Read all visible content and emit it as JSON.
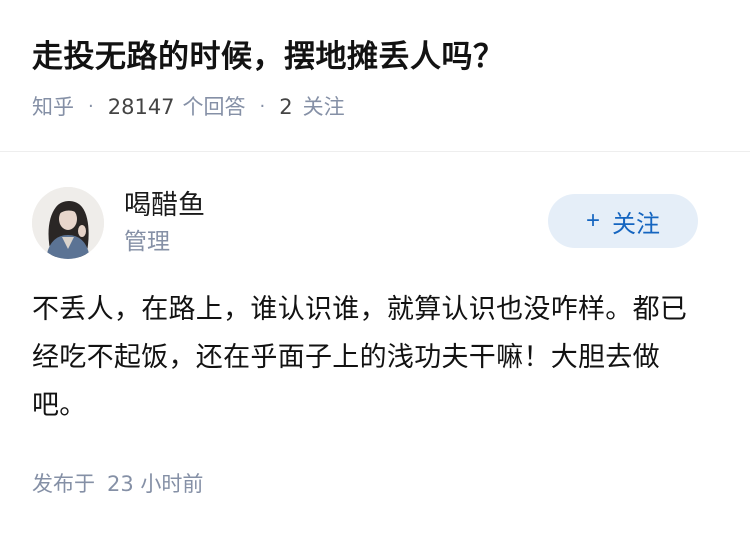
{
  "question": {
    "title": "走投无路的时候，摆地摊丢人吗？",
    "source": "知乎",
    "separator": "·",
    "answer_count": "28147",
    "answer_label": "个回答",
    "follow_count": "2",
    "follow_label": "关注"
  },
  "answer": {
    "author_name": "喝醋鱼",
    "author_tag": "管理",
    "follow_button_plus": "+",
    "follow_button_label": "关注",
    "content": "不丢人，在路上，谁认识谁，就算认识也没咋样。都已经吃不起饭，还在乎面子上的浅功夫干嘛！大胆去做吧。",
    "published_label": "发布于",
    "published_time": "23 小时前"
  },
  "colors": {
    "accent": "#1565c0",
    "follow_bg": "#e5eef8",
    "meta": "#8590a6"
  },
  "icons": {
    "avatar": "avatar-girl-photo"
  }
}
